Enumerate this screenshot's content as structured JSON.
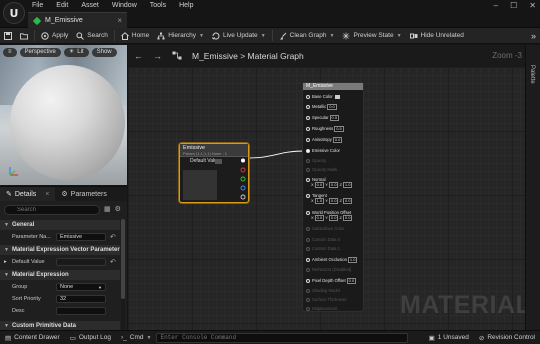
{
  "menubar": {
    "logo_glyph": "U",
    "items": [
      "File",
      "Edit",
      "Asset",
      "Window",
      "Tools",
      "Help"
    ],
    "window_controls": [
      "–",
      "☐",
      "✕"
    ]
  },
  "tab": {
    "title": "M_Emissive",
    "close": "×",
    "accent_color": "#2fb84a"
  },
  "toolbar": {
    "save_icon": "save-icon",
    "browse_icon": "folder-icon",
    "apply": "Apply",
    "search": "Search",
    "home": "Home",
    "hierarchy": "Hierarchy",
    "live_update": "Live Update",
    "clean_graph": "Clean Graph",
    "preview_state": "Preview State",
    "hide_unrelated": "Hide Unrelated",
    "expand": "»"
  },
  "viewport": {
    "menu_icon": "≡",
    "perspective": "Perspective",
    "lit": "Lit",
    "show": "Show"
  },
  "details": {
    "tabs": [
      "Details",
      "Parameters"
    ],
    "search_placeholder": "Search",
    "sections": {
      "general": "General",
      "mev": "Material Expression Vector Parameter",
      "mex": "Material Expression",
      "cpd": "Custom Primitive Data"
    },
    "rows": {
      "param_name_label": "Parameter Na...",
      "param_name_value": "Emissive",
      "default_value_label": "Default Value",
      "group_label": "Group",
      "group_value": "None",
      "sort_priority_label": "Sort Priority",
      "sort_priority_value": "32",
      "desc_label": "Desc"
    }
  },
  "graph": {
    "back": "←",
    "forward": "→",
    "breadcrumb_root": "M_Emissive",
    "breadcrumb_sep": ">",
    "breadcrumb_leaf": "Material Graph",
    "zoom": "Zoom -3",
    "watermark": "MATERIAL",
    "palette": "Palette"
  },
  "vector_node": {
    "title": "Emissive",
    "subtitle": "Param (1,1,1,1)   None : 1",
    "output_label": "Default Value",
    "edge_color": "#d99a1a",
    "wire_color": "#ffffff"
  },
  "material_node": {
    "title": "M_Emissive",
    "pins": {
      "base_color": "Base Color",
      "metallic": "Metallic",
      "metallic_val": "0.0",
      "specular": "Specular",
      "specular_val": "0.5",
      "roughness": "Roughness",
      "roughness_val": "0.5",
      "anisotropy": "Anisotropy",
      "anisotropy_val": "0.0",
      "emissive": "Emissive Color",
      "opacity": "Opacity",
      "opacity_mask": "Opacity Mask",
      "normal": "Normal",
      "normal_vals": [
        "0.0",
        "0.0",
        "1.0"
      ],
      "tangent": "Tangent",
      "tangent_vals": [
        "1.0",
        "0.0",
        "0.0"
      ],
      "wpo": "World Position Offset",
      "wpo_vals": [
        "0.0",
        "0.0",
        "0.0"
      ],
      "subsurface": "Subsurface Color",
      "custom0": "Custom Data 0",
      "custom1": "Custom Data 1",
      "ao": "Ambient Occlusion",
      "ao_val": "1.0",
      "refraction": "Refraction (Disabled)",
      "pdo": "Pixel Depth Offset",
      "pdo_val": "0.0",
      "shading": "Shading Model",
      "surface_thickness": "Surface Thickness",
      "displacement": "Displacement"
    }
  },
  "statusbar": {
    "content_drawer": "Content Drawer",
    "output_log": "Output Log",
    "cmd": "Cmd",
    "console_placeholder": "Enter Console Command",
    "unsaved": "1 Unsaved",
    "revision": "Revision Control"
  }
}
